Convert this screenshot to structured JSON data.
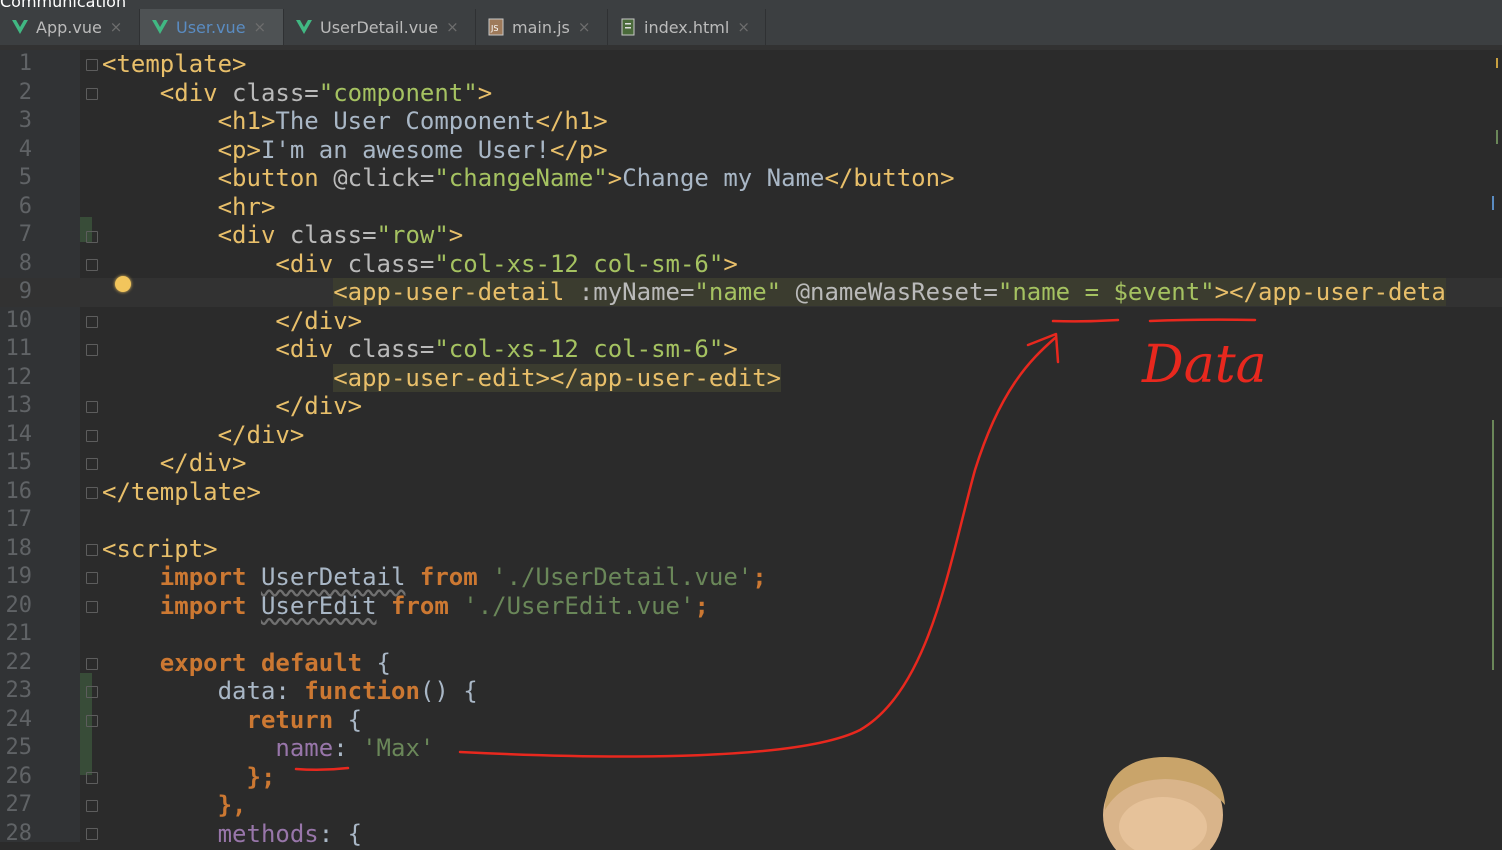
{
  "window_title": "Communication",
  "tabs": [
    {
      "label": "App.vue",
      "icon": "vue-icon",
      "active": false
    },
    {
      "label": "User.vue",
      "icon": "vue-icon",
      "active": true
    },
    {
      "label": "UserDetail.vue",
      "icon": "vue-icon",
      "active": false
    },
    {
      "label": "main.js",
      "icon": "js-file-icon",
      "active": false
    },
    {
      "label": "index.html",
      "icon": "html-file-icon",
      "active": false
    }
  ],
  "line_numbers": [
    "1",
    "2",
    "3",
    "4",
    "5",
    "6",
    "7",
    "8",
    "9",
    "10",
    "11",
    "12",
    "13",
    "14",
    "15",
    "16",
    "17",
    "18",
    "19",
    "20",
    "21",
    "22",
    "23",
    "24",
    "25",
    "26",
    "27",
    "28"
  ],
  "code": {
    "l1": "<template>",
    "l2a": "<div ",
    "l2b": "class=",
    "l2c": "\"component\"",
    "l2d": ">",
    "l3a": "<h1>",
    "l3b": "The User Component",
    "l3c": "</h1>",
    "l4a": "<p>",
    "l4b": "I'm an awesome User!",
    "l4c": "</p>",
    "l5a": "<button ",
    "l5b": "@click=",
    "l5c": "\"changeName\"",
    "l5d": ">",
    "l5e": "Change my Name",
    "l5f": "</button>",
    "l6": "<hr>",
    "l7a": "<div ",
    "l7b": "class=",
    "l7c": "\"row\"",
    "l7d": ">",
    "l8a": "<div ",
    "l8b": "class=",
    "l8c": "\"col-xs-12 col-sm-6\"",
    "l8d": ">",
    "l9a": "<app-user-detail ",
    "l9b": ":myName=",
    "l9c": "\"name\"",
    "l9d": " @nameWasReset=",
    "l9e": "\"name = $event\"",
    "l9f": "></app-user-deta",
    "l10": "</div>",
    "l11a": "<div ",
    "l11b": "class=",
    "l11c": "\"col-xs-12 col-sm-6\"",
    "l11d": ">",
    "l12": "<app-user-edit></app-user-edit>",
    "l13": "</div>",
    "l14": "</div>",
    "l15": "</div>",
    "l16": "</template>",
    "l18": "<script>",
    "l19a": "import ",
    "l19b": "UserDetail",
    "l19c": " from ",
    "l19d": "'./UserDetail.vue'",
    "l19e": ";",
    "l20a": "import ",
    "l20b": "UserEdit",
    "l20c": " from ",
    "l20d": "'./UserEdit.vue'",
    "l20e": ";",
    "l22a": "export default ",
    "l22b": "{",
    "l23a": "data",
    "l23b": ": ",
    "l23c": "function",
    "l23d": "() {",
    "l24a": "return ",
    "l24b": "{",
    "l25a": "name",
    "l25b": ": ",
    "l25c": "'Max'",
    "l26": "};",
    "l27": "},",
    "l28a": "methods",
    "l28b": ": {"
  },
  "annotation": {
    "handwritten_text": "Data",
    "color": "#e8281e"
  },
  "colors": {
    "editor_bg": "#2b2b2b",
    "gutter_bg": "#313335",
    "tag": "#e8bf6a",
    "attr_value": "#a5c261",
    "keyword": "#cc7832",
    "function": "#ffc66d",
    "property": "#9876aa",
    "string": "#6a8759"
  }
}
